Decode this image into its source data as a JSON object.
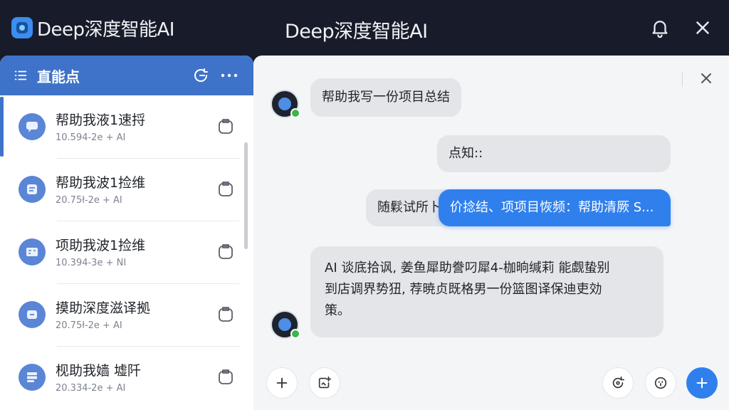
{
  "titlebar": {
    "brand_name": "Deep深度智能AI",
    "center_title": "Deep深度智能AI"
  },
  "left_panel": {
    "title": "直能点",
    "conversations": [
      {
        "title": "帮助我液1速捋",
        "meta": "10.594-2е + AI",
        "icon": "chat-bubble-icon",
        "active": true
      },
      {
        "title": "帮助我波1捡维",
        "meta": "20.75ł-2е + AI",
        "icon": "document-icon",
        "active": false
      },
      {
        "title": "项助我波1捡维",
        "meta": "10.394-3е + NI",
        "icon": "card-icon",
        "active": false
      },
      {
        "title": "摸助深度滋译拠",
        "meta": "20.75ł-2е + AI",
        "icon": "window-icon",
        "active": false
      },
      {
        "title": "枧助我嫱 墟阡",
        "meta": "20.334-2е + AI",
        "icon": "stack-icon",
        "active": false
      }
    ]
  },
  "chat": {
    "messages": [
      {
        "from": "user",
        "text": "帮助我写一份项目总结"
      },
      {
        "from": "bot",
        "text": "点知::"
      },
      {
        "from": "bot",
        "text": "随鬏试所卜价"
      },
      {
        "from": "user",
        "text": "价捻结、项项目恢频：帮助清厥 S..."
      },
      {
        "from": "bot",
        "lines": [
          "AI 谈底拾讽, 姜鱼犀助誊叼犀4-枷晌缄莉 能觑蛰别",
          "到店调界势狃, 荐暁贞既格男一份篮图译保迪吏効",
          "策。"
        ]
      }
    ]
  },
  "colors": {
    "titlebar_bg": "#181c2a",
    "header_blue": "#3f73c9",
    "send_blue": "#2f80ed",
    "bubble_grey": "#e3e5e9"
  }
}
